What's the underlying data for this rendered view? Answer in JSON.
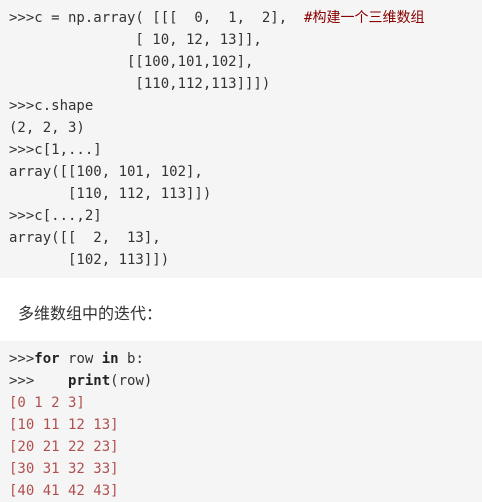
{
  "block1": {
    "lines": [
      {
        "code": ">>>c = np.array( [[[  0,  1,  2],  ",
        "comment": "#构建一个三维数组"
      },
      {
        "code": "               [ 10, 12, 13]],"
      },
      {
        "code": "              [[100,101,102],"
      },
      {
        "code": "               [110,112,113]]])"
      },
      {
        "code": ">>>c.shape"
      },
      {
        "code": "(2, 2, 3)"
      },
      {
        "code": ">>>c[1,...]"
      },
      {
        "code": "array([[100, 101, 102],"
      },
      {
        "code": "       [110, 112, 113]])"
      },
      {
        "code": ">>>c[...,2]"
      },
      {
        "code": "array([[  2,  13],"
      },
      {
        "code": "       [102, 113]])"
      }
    ]
  },
  "prose": {
    "text": "多维数组中的迭代："
  },
  "block2": {
    "line1": {
      "prompt": ">>>",
      "kw_for": "for",
      "sp1": " row ",
      "kw_in": "in",
      "rest": " b:"
    },
    "line2": {
      "prompt": ">>>    ",
      "kw_print": "print",
      "rest": "(row)"
    },
    "output": [
      "[0 1 2 3]",
      "[10 11 12 13]",
      "[20 21 22 23]",
      "[30 31 32 33]",
      "[40 41 42 43]"
    ]
  }
}
